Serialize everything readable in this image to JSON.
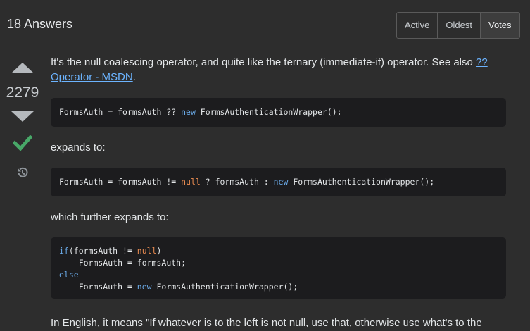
{
  "header": {
    "answers_count": "18 Answers",
    "sort_options": [
      "Active",
      "Oldest",
      "Votes"
    ],
    "active_sort": "Votes"
  },
  "vote": {
    "score": "2279",
    "accepted": true
  },
  "answer": {
    "p1_text": "It's the null coalescing operator, and quite like the ternary (immediate-if) operator. See also ",
    "p1_link": "?? Operator - MSDN",
    "p1_end": ".",
    "code1": {
      "prefix": "FormsAuth = formsAuth ?? ",
      "kw_new": "new",
      "suffix": " FormsAuthenticationWrapper();"
    },
    "p2": "expands to:",
    "code2": {
      "part1": "FormsAuth = formsAuth != ",
      "null": "null",
      "part2": " ? formsAuth : ",
      "kw_new": "new",
      "part3": " FormsAuthenticationWrapper();"
    },
    "p3": "which further expands to:",
    "code3": {
      "kw_if": "if",
      "l1a": "(formsAuth != ",
      "null": "null",
      "l1b": ")",
      "l2": "    FormsAuth = formsAuth;",
      "kw_else": "else",
      "l4a": "    FormsAuth = ",
      "kw_new": "new",
      "l4b": " FormsAuthenticationWrapper();"
    },
    "p4": "In English, it means \"If whatever is to the left is not null, use that, otherwise use what's to the"
  },
  "colors": {
    "background": "#2d2d2d",
    "code_background": "#1c1c1e",
    "link": "#6cb4ff",
    "accepted_green": "#48a868",
    "keyword": "#6aa9e6",
    "literal": "#e88b51"
  }
}
